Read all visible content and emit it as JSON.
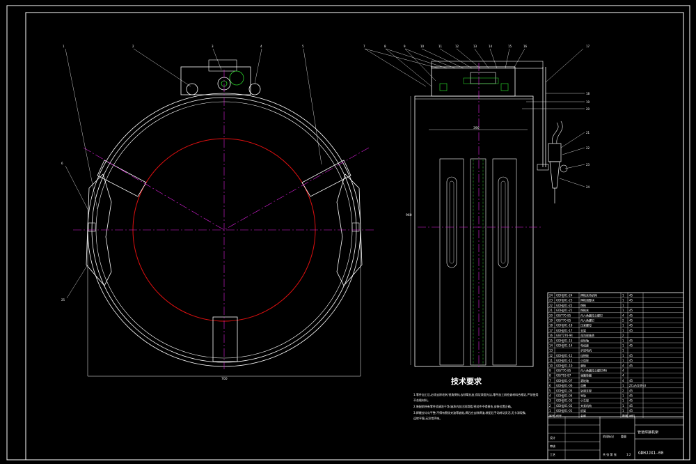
{
  "drawing": {
    "tech_req_title": "技术要求",
    "tech_req_lines": [
      "1.零件加工后,必须去除毛刺,锐角倒钝,去除氧化皮,保证表面光洁,零件加工前检查材料合格证,严禁使用",
      "不合格材料。",
      "2.装配前所有零件须清洗干净,轴承内加注润滑脂,密封件不得损伤,安装位置正确。",
      "3.焊缝应均匀平整,不得有裂纹夹渣等缺陷,焊后应去除焊渣,装配后手动转动灵活,无卡滞现象,",
      "运转平稳,无异常声响。"
    ],
    "drawing_number": "GDHJJX1-00",
    "title_name": "管道焊接机架",
    "dim_front_width": "700",
    "dim_side_width": "390",
    "dim_side_height": "960",
    "front_callouts": [
      "1",
      "2",
      "3",
      "4",
      "5",
      "6",
      "25"
    ],
    "side_callouts_top": [
      "7",
      "8",
      "9",
      "10",
      "11",
      "12",
      "13",
      "14",
      "15",
      "16"
    ],
    "side_callouts_right": [
      "17",
      "18",
      "19",
      "20",
      "21",
      "22",
      "23",
      "24"
    ],
    "bom_rows": [
      {
        "no": "24",
        "code": "GDHJJX1-24",
        "name": "焊枪夹持机构",
        "qty": "1",
        "mat": "45"
      },
      {
        "no": "23",
        "code": "GDHJJX1-23",
        "name": "焊枪调整块",
        "qty": "1",
        "mat": "45"
      },
      {
        "no": "22",
        "code": "GDHJJX1-22",
        "name": "焊枪",
        "qty": "1",
        "mat": ""
      },
      {
        "no": "21",
        "code": "GDHJJX1-21",
        "name": "焊枪夹",
        "qty": "1",
        "mat": "45"
      },
      {
        "no": "20",
        "code": "GB/T70-85",
        "name": "内六角圆柱头螺钉",
        "qty": "4",
        "mat": "45"
      },
      {
        "no": "19",
        "code": "GB/T70-85",
        "name": "内六角螺钉",
        "qty": "2",
        "mat": "45"
      },
      {
        "no": "18",
        "code": "GDHJJX1-18",
        "name": "压紧螺母",
        "qty": "1",
        "mat": "45"
      },
      {
        "no": "17",
        "code": "GDHJJX1-17",
        "name": "支架",
        "qty": "1",
        "mat": "45"
      },
      {
        "no": "16",
        "code": "GB/T276-94",
        "name": "深沟球轴承",
        "qty": "2",
        "mat": ""
      },
      {
        "no": "15",
        "code": "GDHJJX1-15",
        "name": "齿轮轴",
        "qty": "1",
        "mat": "45"
      },
      {
        "no": "14",
        "code": "GDHJJX1-14",
        "name": "电机座",
        "qty": "1",
        "mat": "45"
      },
      {
        "no": "13",
        "code": "",
        "name": "步进电机",
        "qty": "1",
        "mat": ""
      },
      {
        "no": "12",
        "code": "GDHJJX1-12",
        "name": "连接板",
        "qty": "1",
        "mat": "45"
      },
      {
        "no": "11",
        "code": "GDHJJX1-11",
        "name": "小齿轮",
        "qty": "1",
        "mat": "45"
      },
      {
        "no": "10",
        "code": "GDHJJX1-10",
        "name": "滚轮",
        "qty": "4",
        "mat": "45"
      },
      {
        "no": "9",
        "code": "GB/T70-85",
        "name": "内六角圆柱头螺钉M6",
        "qty": "4",
        "mat": ""
      },
      {
        "no": "8",
        "code": "GB/T93-87",
        "name": "弹簧垫圈",
        "qty": "4",
        "mat": ""
      },
      {
        "no": "7",
        "code": "GDHJJX1-07",
        "name": "滚轮轴",
        "qty": "4",
        "mat": "45"
      },
      {
        "no": "6",
        "code": "GDHJJX1-06",
        "name": "齿圈",
        "qty": "1",
        "mat": "ZCuAl10Fe3"
      },
      {
        "no": "5",
        "code": "GDHJJX1-05",
        "name": "轨道支架",
        "qty": "2",
        "mat": "45"
      },
      {
        "no": "4",
        "code": "GDHJJX1-04",
        "name": "导轨",
        "qty": "1",
        "mat": "45"
      },
      {
        "no": "3",
        "code": "GDHJJX1-03",
        "name": "小车架",
        "qty": "1",
        "mat": "45"
      },
      {
        "no": "2",
        "code": "GDHJJX1-02",
        "name": "夹紧机构",
        "qty": "1",
        "mat": "45"
      },
      {
        "no": "1",
        "code": "GDHJJX1-01",
        "name": "机架",
        "qty": "1",
        "mat": "45"
      }
    ],
    "bom_header": {
      "no": "序号",
      "code": "代号",
      "name": "名称",
      "qty": "数量",
      "mat": "材料"
    },
    "tb_labels": {
      "design": "设计",
      "check": "审核",
      "process": "工艺",
      "approve": "批准",
      "scale": "比例",
      "scale_value": "1:2",
      "sheet": "共 张 第 张",
      "stage": "阶段标记",
      "weight": "重量"
    }
  }
}
